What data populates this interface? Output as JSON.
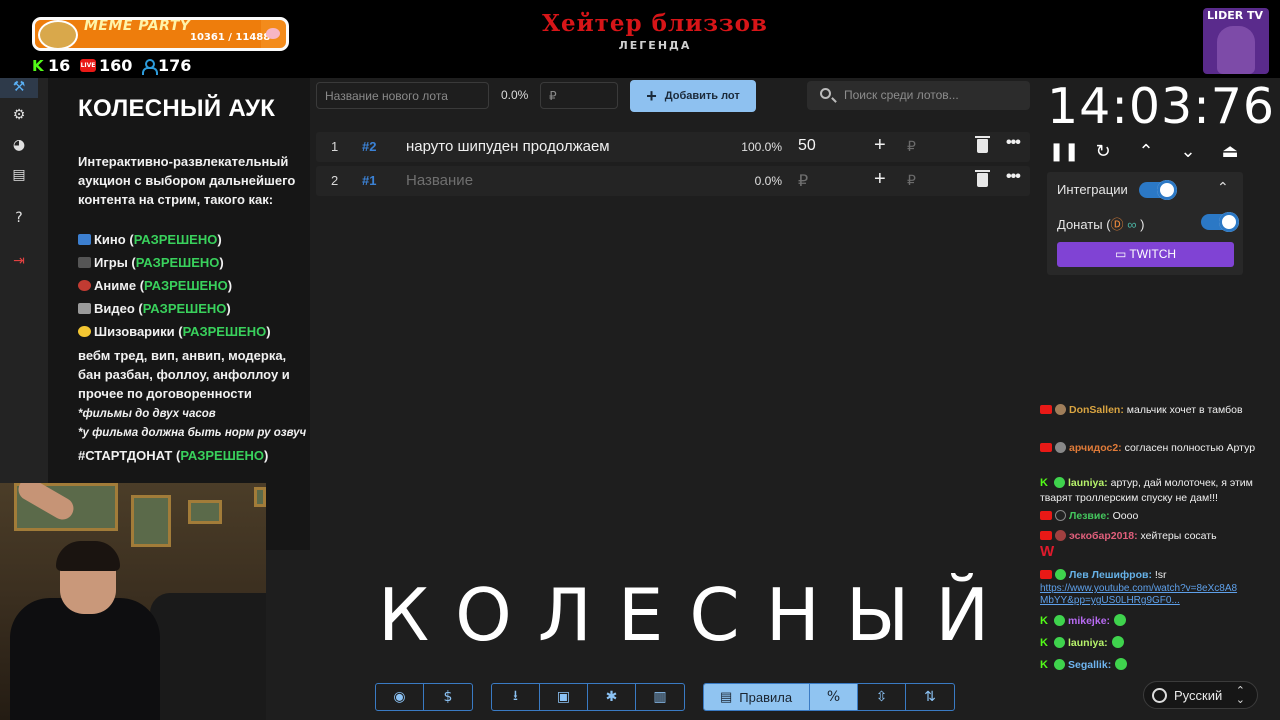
{
  "overlay": {
    "meme_bar": {
      "title": "MEME PARTY",
      "counter": "10361 / 11488",
      "progress": 0.902
    },
    "stats": {
      "kick_viewers": "16",
      "live_viewers": "160",
      "followers": "176"
    },
    "center_title": "Хейтер близзов",
    "center_subtitle": "ЛЕГЕНДА",
    "channel_logo_text": "LIDER TV"
  },
  "sidebar": {
    "items": [
      "hammer-icon",
      "gear-icon",
      "pie-chart-icon",
      "clipboard-icon",
      "help-icon",
      "logout-icon"
    ]
  },
  "panel": {
    "title": "КОЛЕСНЫЙ АУК",
    "description": "Интерактивно-развлекательный аукцион с выбором дальнейшего контента на стрим, такого как:",
    "categories": [
      {
        "label": "Кино",
        "status": "РАЗРЕШЕНО"
      },
      {
        "label": "Игры",
        "status": "РАЗРЕШЕНО"
      },
      {
        "label": "Аниме",
        "status": "РАЗРЕШЕНО"
      },
      {
        "label": "Видео",
        "status": "РАЗРЕШЕНО"
      },
      {
        "label": "Шизоварики",
        "status": "РАЗРЕШЕНО"
      }
    ],
    "misc": "вебм тред, вип, анвип, модерка, бан разбан, фоллоу, анфоллоу и прочее по договоренности",
    "note1": "*фильмы до двух часов",
    "note2": "*у фильма должна быть норм ру озвуч",
    "hashtag": "#СТАРТДОНАТ",
    "hashtag_status": "РАЗРЕШЕНО"
  },
  "new_lot": {
    "placeholder": "Название нового лота",
    "percent": "0.0%",
    "amount_placeholder": "₽",
    "add_label": "Добавить лот"
  },
  "search": {
    "placeholder": "Поиск среди лотов..."
  },
  "lots": [
    {
      "index": "1",
      "id": "#2",
      "name": "наруто шипуден продолжаем",
      "percent": "100.0%",
      "amount": "50"
    },
    {
      "index": "2",
      "id": "#1",
      "name": "Название",
      "percent": "0.0%",
      "amount": "₽"
    }
  ],
  "timer": {
    "value": "14:03:76"
  },
  "integrations": {
    "label": "Интеграции",
    "donations_label": "Донаты (",
    "donations_close": ")",
    "twitch_label": "TWITCH"
  },
  "chat": {
    "messages": [
      {
        "user": "DonSallen:",
        "text": "мальчик хочет в тамбов",
        "color": "#d9a441"
      },
      {
        "user": "арчидос2:",
        "text": "согласен полностью Артур",
        "color": "#e07b39"
      },
      {
        "user": "launiya:",
        "text": "артур, дай молоточек, я этим тварят троллерским спуску не дам!!!",
        "color": "#b7f36b"
      },
      {
        "user": "Лезвие:",
        "text": "Оооо",
        "color": "#45c75e"
      },
      {
        "user": "эскобар2018:",
        "text": "хейтеры сосать",
        "color": "#e05f7b"
      },
      {
        "user": "Лев Лешифров:",
        "text": "!sr",
        "color": "#66b2e8"
      },
      {
        "link": "https://www.youtube.com/watch?v=8eXc8A8MbYY&pp=ygUS0LHRg9GF0..."
      },
      {
        "user": "mikejke:",
        "text": "",
        "color": "#b86bf3"
      },
      {
        "user": "launiya:",
        "text": "",
        "color": "#b7f36b"
      },
      {
        "user": "Segallik:",
        "text": "",
        "color": "#6fb5f0"
      }
    ]
  },
  "big_word": "КОЛЕСНЫЙ",
  "toolbar": {
    "rules_label": "Правила"
  },
  "language": {
    "label": "Русский"
  }
}
